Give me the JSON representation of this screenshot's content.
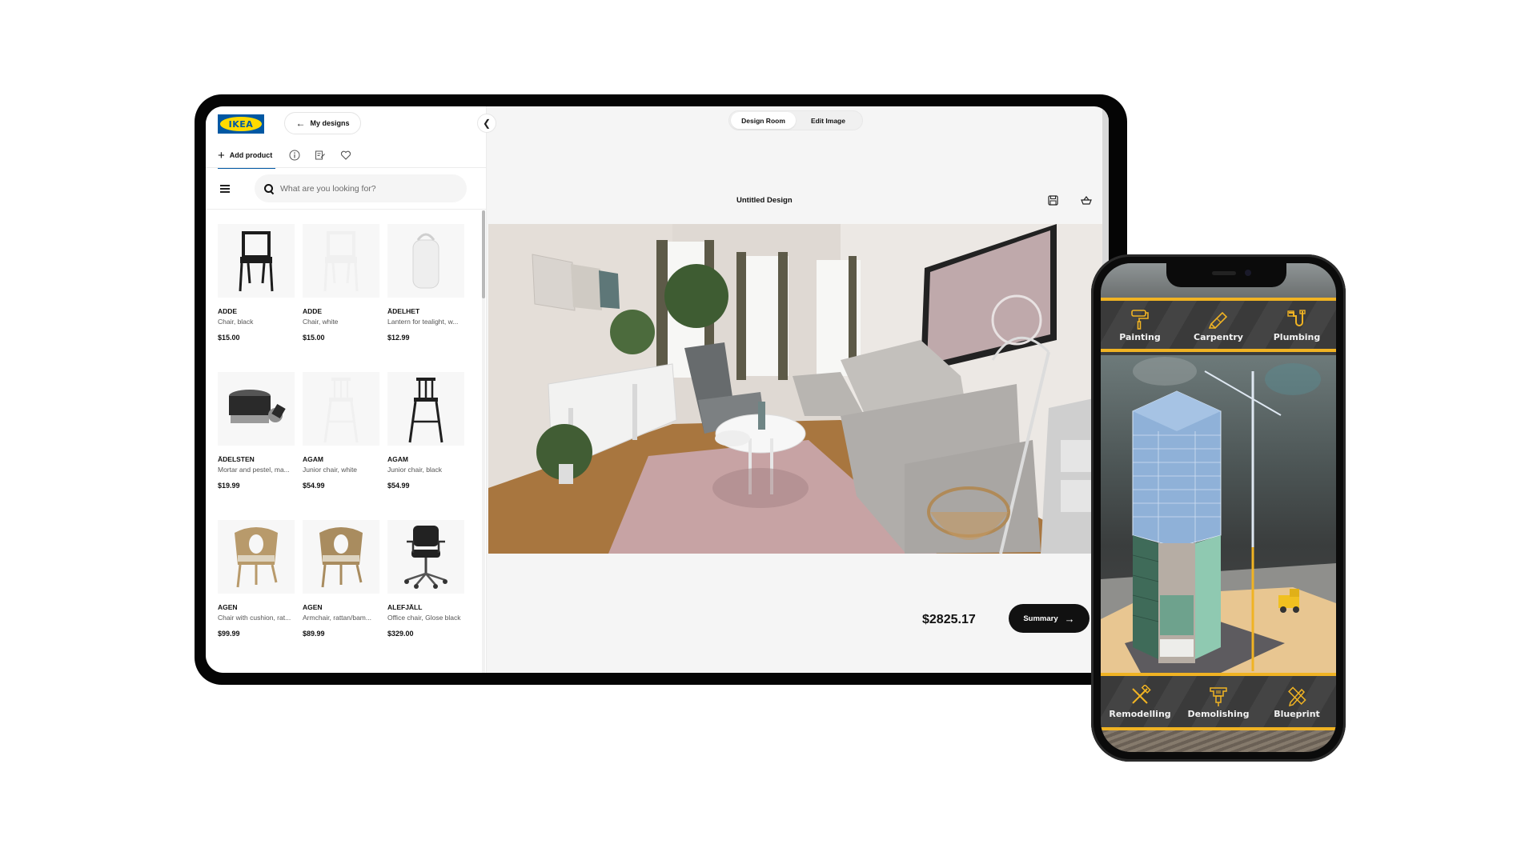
{
  "tablet": {
    "brand": "IKEA",
    "nav": {
      "back_label": "My designs",
      "collapse_icon": "chevron-left-icon"
    },
    "toolbar": {
      "add_product_label": "Add product",
      "icons": [
        "info-icon",
        "edit-list-icon",
        "heart-icon"
      ]
    },
    "search": {
      "placeholder": "What are you looking for?",
      "value": ""
    },
    "products": [
      {
        "name": "ADDE",
        "desc": "Chair, black",
        "price": "$15.00",
        "kind": "chair",
        "color": "#1d1d1d"
      },
      {
        "name": "ADDE",
        "desc": "Chair, white",
        "price": "$15.00",
        "kind": "chair",
        "color": "#f0f0f0"
      },
      {
        "name": "ÄDELHET",
        "desc": "Lantern for tealight, w...",
        "price": "$12.99",
        "kind": "lantern",
        "color": "#eeeeee"
      },
      {
        "name": "ÄDELSTEN",
        "desc": "Mortar and pestel, ma...",
        "price": "$19.99",
        "kind": "mortar",
        "color": "#2a2a2a"
      },
      {
        "name": "AGAM",
        "desc": "Junior chair, white",
        "price": "$54.99",
        "kind": "highchair",
        "color": "#f0f0f0"
      },
      {
        "name": "AGAM",
        "desc": "Junior chair, black",
        "price": "$54.99",
        "kind": "highchair",
        "color": "#1f1f1f"
      },
      {
        "name": "AGEN",
        "desc": "Chair with cushion, rat...",
        "price": "$99.99",
        "kind": "rattan",
        "color": "#b89a6b"
      },
      {
        "name": "AGEN",
        "desc": "Armchair, rattan/bam...",
        "price": "$89.99",
        "kind": "rattan",
        "color": "#a98c5f"
      },
      {
        "name": "ALEFJÄLL",
        "desc": "Office chair, Glose black",
        "price": "$329.00",
        "kind": "office",
        "color": "#222222"
      }
    ],
    "tabs": [
      {
        "label": "Design Room",
        "active": true
      },
      {
        "label": "Edit Image",
        "active": false
      }
    ],
    "design_title": "Untitled Design",
    "header_icons": [
      "save-icon",
      "basket-icon"
    ],
    "total_price": "$2825.17",
    "summary_label": "Summary"
  },
  "phone": {
    "top_services": [
      {
        "label": "Painting",
        "icon": "paint-roller-icon"
      },
      {
        "label": "Carpentry",
        "icon": "saw-icon"
      },
      {
        "label": "Plumbing",
        "icon": "pipe-icon"
      }
    ],
    "bottom_services": [
      {
        "label": "Remodelling",
        "icon": "hammer-wrench-icon"
      },
      {
        "label": "Demolishing",
        "icon": "jackhammer-icon"
      },
      {
        "label": "Blueprint",
        "icon": "ruler-pencil-icon"
      }
    ],
    "accent_color": "#f0b323"
  }
}
